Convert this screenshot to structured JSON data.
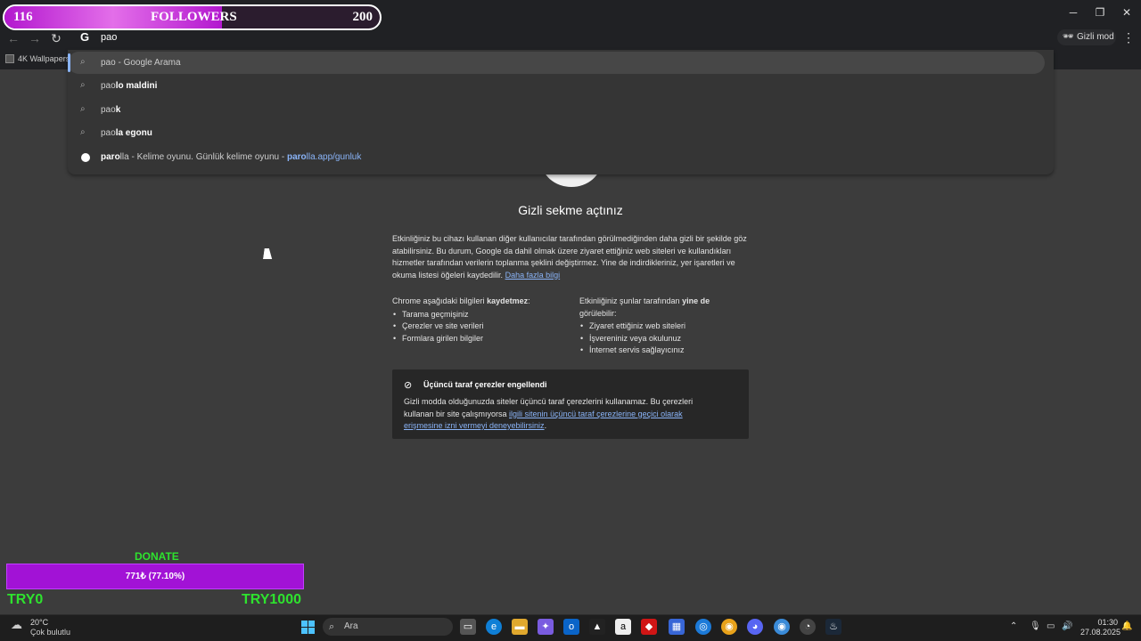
{
  "followers_bar": {
    "current": "116",
    "label": "FOLLOWERS",
    "goal": "200",
    "progress": 0.58
  },
  "browser": {
    "omnibox_text": "pao",
    "incognito_label": "Gizli mod",
    "bookmark": "4K Wallpapers"
  },
  "suggestions": [
    {
      "pre": "pao",
      "bold": "",
      "rest": " - Google Arama",
      "link": "",
      "icon": "search-icon"
    },
    {
      "pre": "pao",
      "bold": "lo maldini",
      "rest": "",
      "link": "",
      "icon": "search-icon"
    },
    {
      "pre": "pao",
      "bold": "k",
      "rest": "",
      "link": "",
      "icon": "search-icon"
    },
    {
      "pre": "pao",
      "bold": "la egonu",
      "rest": "",
      "link": "",
      "icon": "search-icon"
    },
    {
      "pre": "par",
      "bold": "o",
      "rest": "lla - Kelime oyunu. Günlük kelime oyunu - ",
      "link_bold": "paro",
      "link": "lla.app/gunluk",
      "icon": "site-icon"
    }
  ],
  "page": {
    "title": "Gizli sekme açtınız",
    "intro": "Etkinliğiniz bu cihazı kullanan diğer kullanıcılar tarafından görülmediğinden daha gizli bir şekilde göz atabilirsiniz. Bu durum, Google da dahil olmak üzere ziyaret ettiğiniz web siteleri ve kullandıkları hizmetler tarafından verilerin toplanma şeklini değiştirmez. Yine de indirdikleriniz, yer işaretleri ve okuma listesi öğeleri kaydedilir.",
    "learn_more": "Daha fazla bilgi",
    "left_heading_a": "Chrome aşağıdaki bilgileri ",
    "left_heading_b": "kaydetmez",
    "left_heading_c": ":",
    "left_items": [
      "Tarama geçmişiniz",
      "Çerezler ve site verileri",
      "Formlara girilen bilgiler"
    ],
    "right_heading_a": "Etkinliğiniz şunlar tarafından ",
    "right_heading_b": "yine de",
    "right_heading_c": " görülebilir:",
    "right_items": [
      "Ziyaret ettiğiniz web siteleri",
      "İşvereniniz veya okulunuz",
      "İnternet servis sağlayıcınız"
    ],
    "third_party_title": "Üçüncü taraf çerezler engellendi",
    "third_party_body": "Gizli modda olduğunuzda siteler üçüncü taraf çerezlerini kullanamaz. Bu çerezleri kullanan bir site çalışmıyorsa ",
    "third_party_link": "ilgili sitenin üçüncü taraf çerezlerine geçici olarak erişmesine izni vermeyi deneyebilirsiniz",
    "third_party_end": "."
  },
  "donate": {
    "label": "DONATE",
    "bar_text": "771₺ (77.10%)",
    "progress": 0.771,
    "min": "TRY0",
    "max": "TRY1000"
  },
  "taskbar": {
    "weather_temp": "20°C",
    "weather_desc": "Çok bulutlu",
    "search_placeholder": "Ara",
    "time": "01:30",
    "date": "27.08.2025"
  },
  "colors": {
    "accent_purple": "#a212d6",
    "donate_green": "#2ee32e",
    "link_blue": "#8ab4f8"
  }
}
